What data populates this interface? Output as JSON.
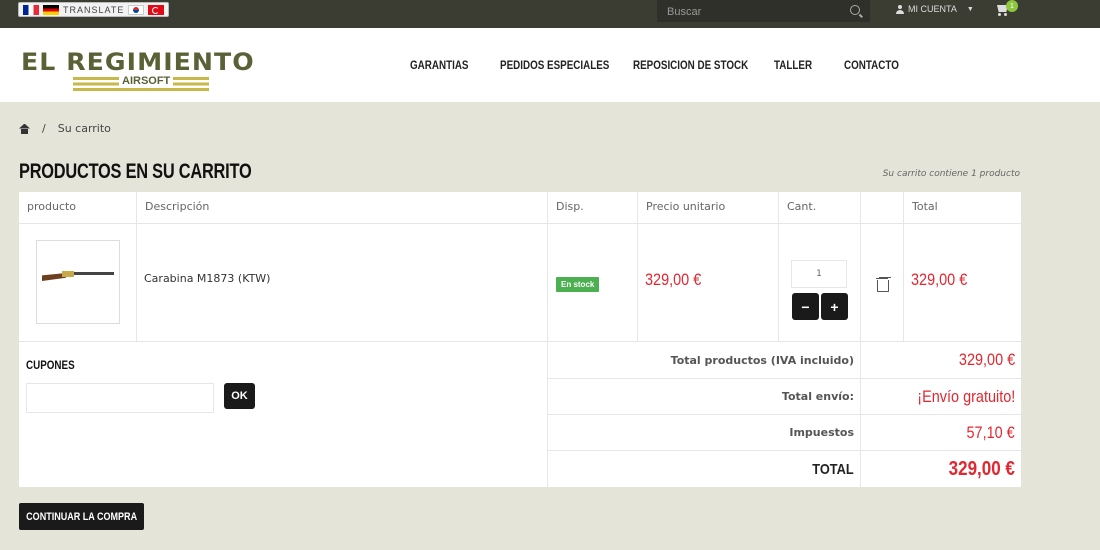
{
  "topbar": {
    "translate_label": "TRANSLATE",
    "search_placeholder": "Buscar",
    "account_label": "MI CUENTA",
    "cart_count": "1"
  },
  "header": {
    "logo_text": "EL REGIMIENTO",
    "logo_sub": "AIRSOFT",
    "nav": [
      "GARANTIAS",
      "PEDIDOS ESPECIALES",
      "REPOSICION DE STOCK",
      "TALLER",
      "CONTACTO"
    ]
  },
  "breadcrumb": {
    "separator": "/",
    "current": "Su carrito"
  },
  "page": {
    "title": "PRODUCTOS EN SU CARRITO",
    "cart_summary": "Su carrito contiene 1 producto"
  },
  "table": {
    "headers": [
      "producto",
      "Descripción",
      "Disp.",
      "Precio unitario",
      "Cant.",
      "",
      "Total"
    ],
    "rows": [
      {
        "description": "Carabina M1873 (KTW)",
        "availability": "En stock",
        "unit_price": "329,00 €",
        "quantity": "1",
        "total": "329,00 €"
      }
    ]
  },
  "coupons": {
    "title": "CUPONES",
    "button": "OK"
  },
  "summary": {
    "products_label": "Total productos (IVA incluido)",
    "products_value": "329,00 €",
    "shipping_label": "Total envío:",
    "shipping_value": "¡Envío gratuito!",
    "tax_label": "Impuestos",
    "tax_value": "57,10 €",
    "total_label": "TOTAL",
    "total_value": "329,00 €"
  },
  "actions": {
    "continue": "CONTINUAR LA COMPRA"
  },
  "colors": {
    "accent_red": "#e3262f",
    "topbar": "#3c3d32",
    "stock_green": "#4caf50",
    "badge_green": "#8dc63f"
  }
}
